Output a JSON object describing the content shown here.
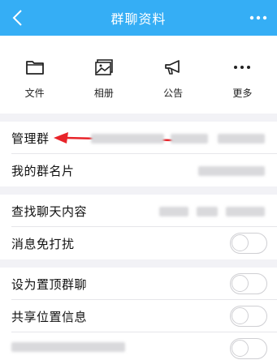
{
  "nav": {
    "title": "群聊资料",
    "back_icon": "chevron-left-icon",
    "more_icon": "more-dots-icon",
    "bg_color": "#35aef5"
  },
  "toolbar": [
    {
      "label": "文件",
      "icon": "folder-icon"
    },
    {
      "label": "相册",
      "icon": "photo-album-icon"
    },
    {
      "label": "公告",
      "icon": "megaphone-icon"
    },
    {
      "label": "更多",
      "icon": "more-dots-icon"
    }
  ],
  "rows": {
    "manage_group": "管理群",
    "my_group_card": "我的群名片",
    "search_chat": "查找聊天内容",
    "mute_messages": "消息免打扰",
    "pin_top": "设为置顶群聊",
    "share_location": "共享位置信息"
  },
  "annotation": {
    "arrow_color": "#e8242a"
  }
}
